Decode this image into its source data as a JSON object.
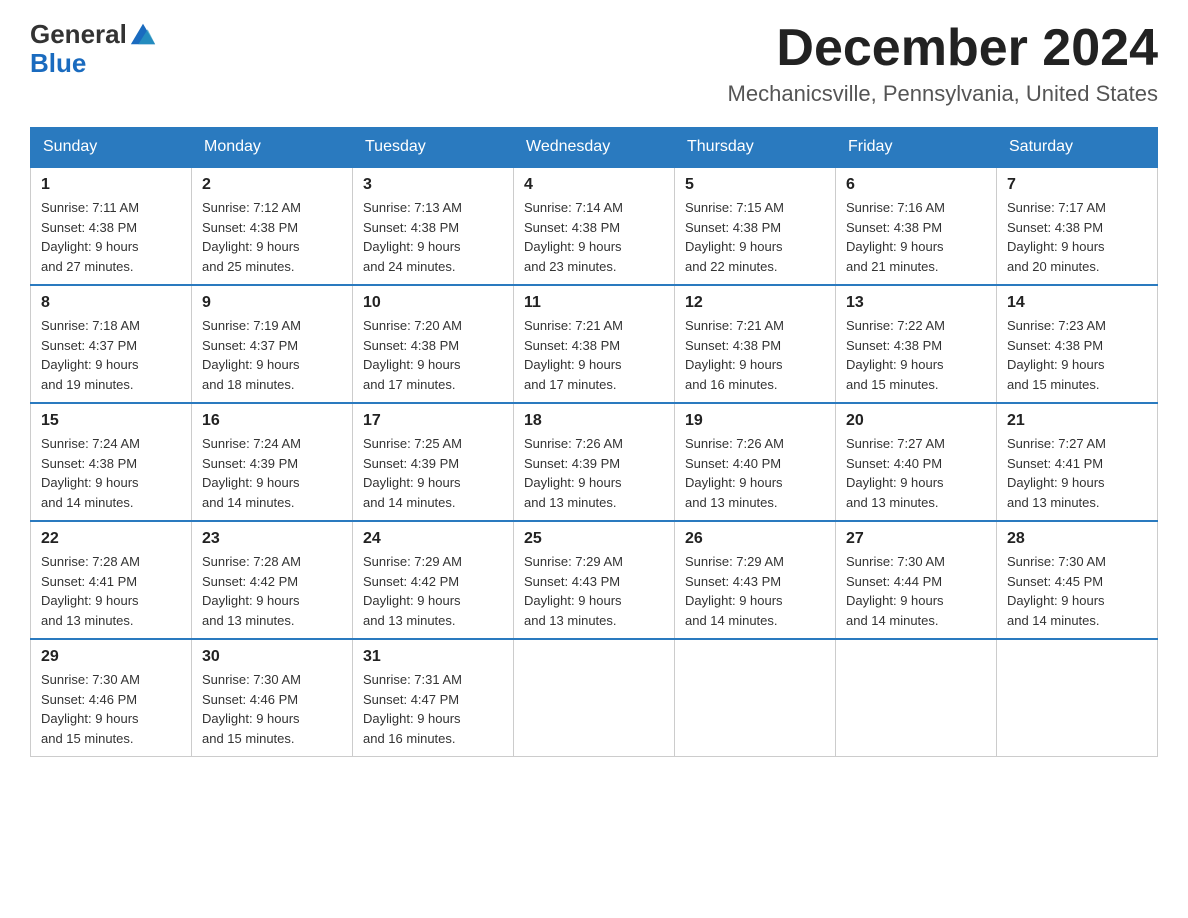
{
  "header": {
    "logo_general": "General",
    "logo_blue": "Blue",
    "month_title": "December 2024",
    "location": "Mechanicsville, Pennsylvania, United States"
  },
  "weekdays": [
    "Sunday",
    "Monday",
    "Tuesday",
    "Wednesday",
    "Thursday",
    "Friday",
    "Saturday"
  ],
  "weeks": [
    [
      {
        "day": "1",
        "sunrise": "7:11 AM",
        "sunset": "4:38 PM",
        "daylight": "9 hours and 27 minutes."
      },
      {
        "day": "2",
        "sunrise": "7:12 AM",
        "sunset": "4:38 PM",
        "daylight": "9 hours and 25 minutes."
      },
      {
        "day": "3",
        "sunrise": "7:13 AM",
        "sunset": "4:38 PM",
        "daylight": "9 hours and 24 minutes."
      },
      {
        "day": "4",
        "sunrise": "7:14 AM",
        "sunset": "4:38 PM",
        "daylight": "9 hours and 23 minutes."
      },
      {
        "day": "5",
        "sunrise": "7:15 AM",
        "sunset": "4:38 PM",
        "daylight": "9 hours and 22 minutes."
      },
      {
        "day": "6",
        "sunrise": "7:16 AM",
        "sunset": "4:38 PM",
        "daylight": "9 hours and 21 minutes."
      },
      {
        "day": "7",
        "sunrise": "7:17 AM",
        "sunset": "4:38 PM",
        "daylight": "9 hours and 20 minutes."
      }
    ],
    [
      {
        "day": "8",
        "sunrise": "7:18 AM",
        "sunset": "4:37 PM",
        "daylight": "9 hours and 19 minutes."
      },
      {
        "day": "9",
        "sunrise": "7:19 AM",
        "sunset": "4:37 PM",
        "daylight": "9 hours and 18 minutes."
      },
      {
        "day": "10",
        "sunrise": "7:20 AM",
        "sunset": "4:38 PM",
        "daylight": "9 hours and 17 minutes."
      },
      {
        "day": "11",
        "sunrise": "7:21 AM",
        "sunset": "4:38 PM",
        "daylight": "9 hours and 17 minutes."
      },
      {
        "day": "12",
        "sunrise": "7:21 AM",
        "sunset": "4:38 PM",
        "daylight": "9 hours and 16 minutes."
      },
      {
        "day": "13",
        "sunrise": "7:22 AM",
        "sunset": "4:38 PM",
        "daylight": "9 hours and 15 minutes."
      },
      {
        "day": "14",
        "sunrise": "7:23 AM",
        "sunset": "4:38 PM",
        "daylight": "9 hours and 15 minutes."
      }
    ],
    [
      {
        "day": "15",
        "sunrise": "7:24 AM",
        "sunset": "4:38 PM",
        "daylight": "9 hours and 14 minutes."
      },
      {
        "day": "16",
        "sunrise": "7:24 AM",
        "sunset": "4:39 PM",
        "daylight": "9 hours and 14 minutes."
      },
      {
        "day": "17",
        "sunrise": "7:25 AM",
        "sunset": "4:39 PM",
        "daylight": "9 hours and 14 minutes."
      },
      {
        "day": "18",
        "sunrise": "7:26 AM",
        "sunset": "4:39 PM",
        "daylight": "9 hours and 13 minutes."
      },
      {
        "day": "19",
        "sunrise": "7:26 AM",
        "sunset": "4:40 PM",
        "daylight": "9 hours and 13 minutes."
      },
      {
        "day": "20",
        "sunrise": "7:27 AM",
        "sunset": "4:40 PM",
        "daylight": "9 hours and 13 minutes."
      },
      {
        "day": "21",
        "sunrise": "7:27 AM",
        "sunset": "4:41 PM",
        "daylight": "9 hours and 13 minutes."
      }
    ],
    [
      {
        "day": "22",
        "sunrise": "7:28 AM",
        "sunset": "4:41 PM",
        "daylight": "9 hours and 13 minutes."
      },
      {
        "day": "23",
        "sunrise": "7:28 AM",
        "sunset": "4:42 PM",
        "daylight": "9 hours and 13 minutes."
      },
      {
        "day": "24",
        "sunrise": "7:29 AM",
        "sunset": "4:42 PM",
        "daylight": "9 hours and 13 minutes."
      },
      {
        "day": "25",
        "sunrise": "7:29 AM",
        "sunset": "4:43 PM",
        "daylight": "9 hours and 13 minutes."
      },
      {
        "day": "26",
        "sunrise": "7:29 AM",
        "sunset": "4:43 PM",
        "daylight": "9 hours and 14 minutes."
      },
      {
        "day": "27",
        "sunrise": "7:30 AM",
        "sunset": "4:44 PM",
        "daylight": "9 hours and 14 minutes."
      },
      {
        "day": "28",
        "sunrise": "7:30 AM",
        "sunset": "4:45 PM",
        "daylight": "9 hours and 14 minutes."
      }
    ],
    [
      {
        "day": "29",
        "sunrise": "7:30 AM",
        "sunset": "4:46 PM",
        "daylight": "9 hours and 15 minutes."
      },
      {
        "day": "30",
        "sunrise": "7:30 AM",
        "sunset": "4:46 PM",
        "daylight": "9 hours and 15 minutes."
      },
      {
        "day": "31",
        "sunrise": "7:31 AM",
        "sunset": "4:47 PM",
        "daylight": "9 hours and 16 minutes."
      },
      null,
      null,
      null,
      null
    ]
  ],
  "labels": {
    "sunrise": "Sunrise:",
    "sunset": "Sunset:",
    "daylight": "Daylight:"
  }
}
